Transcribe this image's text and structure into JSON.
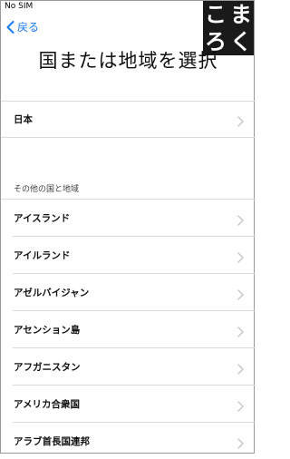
{
  "status_bar": {
    "carrier": "No SIM"
  },
  "nav": {
    "back_label": "戻る"
  },
  "watermark": {
    "chars": [
      "こ",
      "ま",
      "ろ",
      "く"
    ]
  },
  "title": "国または地域を選択",
  "primary": {
    "label": "日本"
  },
  "other_section": {
    "header": "その他の国と地域",
    "items": [
      {
        "label": "アイスランド"
      },
      {
        "label": "アイルランド"
      },
      {
        "label": "アゼルバイジャン"
      },
      {
        "label": "アセンション島"
      },
      {
        "label": "アフガニスタン"
      },
      {
        "label": "アメリカ合衆国"
      },
      {
        "label": "アラブ首長国連邦"
      }
    ]
  },
  "colors": {
    "accent": "#1a7cf5",
    "watermark_bg": "#1a1a1a",
    "divider": "#dcdcdc",
    "chevron": "#c7c7cc"
  }
}
